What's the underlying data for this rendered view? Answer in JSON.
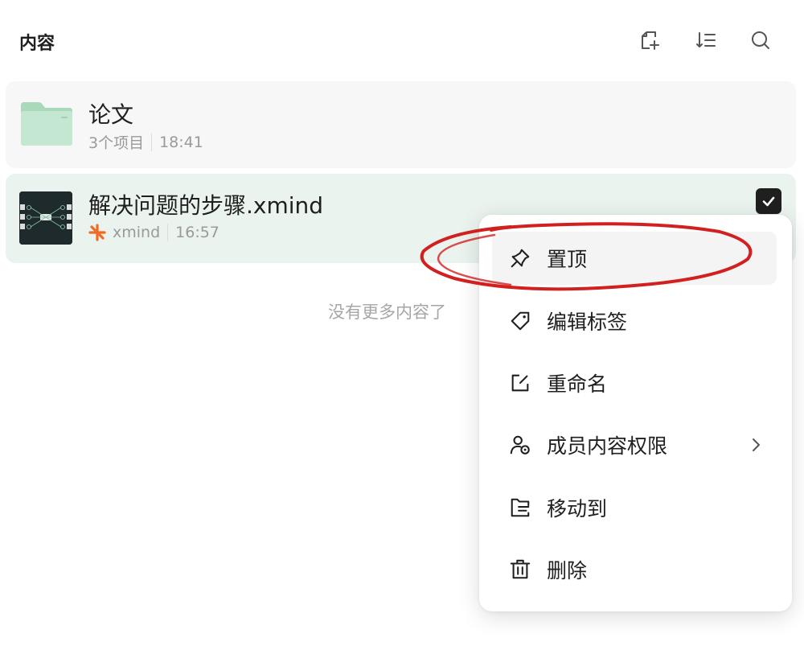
{
  "header": {
    "title": "内容",
    "actions": [
      {
        "name": "new-file-icon"
      },
      {
        "name": "sort-icon"
      },
      {
        "name": "search-icon"
      }
    ]
  },
  "items": [
    {
      "type": "folder",
      "title": "论文",
      "count": "3个项目",
      "time": "18:41",
      "icon": "folder-icon"
    },
    {
      "type": "xmind",
      "title": "解决问题的步骤.xmind",
      "app": "xmind",
      "time": "16:57",
      "icon": "xmind-logo-icon",
      "checked": true
    }
  ],
  "empty_hint": "没有更多内容了",
  "context_menu": {
    "items": [
      {
        "label": "置顶",
        "icon": "pin-icon"
      },
      {
        "label": "编辑标签",
        "icon": "tag-icon"
      },
      {
        "label": "重命名",
        "icon": "rename-icon"
      },
      {
        "label": "成员内容权限",
        "icon": "member-permission-icon",
        "has_submenu": true
      },
      {
        "label": "移动到",
        "icon": "move-to-folder-icon"
      },
      {
        "label": "删除",
        "icon": "trash-icon"
      }
    ]
  },
  "colors": {
    "folder_green": "#bfe3cc",
    "selected_bg": "#eaf3ee",
    "annotation_red": "#d21f1f",
    "xmind_orange": "#f06a23"
  }
}
